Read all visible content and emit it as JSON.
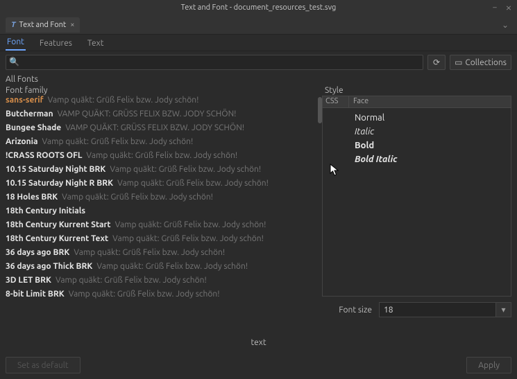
{
  "window": {
    "title": "Text and Font - document_resources_test.svg"
  },
  "doc_tab": {
    "label": "Text and Font",
    "icon": "T"
  },
  "subtabs": [
    {
      "label": "Font",
      "active": true
    },
    {
      "label": "Features",
      "active": false
    },
    {
      "label": "Text",
      "active": false
    }
  ],
  "toolbar": {
    "search_placeholder": "",
    "collections_label": "Collections"
  },
  "section_labels": {
    "all_fonts": "All Fonts",
    "font_family": "Font family",
    "style": "Style",
    "css": "CSS",
    "face": "Face",
    "font_size": "Font size",
    "text": "text"
  },
  "font_list": [
    {
      "name": "sans-serif",
      "selected": true,
      "preview": "Vamp quäkt: Grüß Felix bzw. Jody schön!"
    },
    {
      "name": "Butcherman",
      "preview": "VAMP QUÄKT: GRÜSS FELIX BZW. JODY SCHÖN!"
    },
    {
      "name": "Bungee Shade",
      "preview": "VAMP QUÄKT: GRÜSS FELIX BZW. JODY SCHÖN!"
    },
    {
      "name": "Arizonia",
      "preview": "Vamp quäkt: Grüß Felix bzw. Jody schön!"
    },
    {
      "name": "!CRASS ROOTS OFL",
      "preview": "Vamp quäkt: Grüß Felix bzw. Jody schön!"
    },
    {
      "name": "10.15 Saturday Night BRK",
      "preview": "Vamp quäkt: Grüß Felix bzw. Jody schön!"
    },
    {
      "name": "10.15 Saturday Night R BRK",
      "preview": "Vamp quäkt: Grüß Felix bzw. Jody schön!"
    },
    {
      "name": "18 Holes BRK",
      "preview": "Vamp quäkt: Grüß Felix bzw. Jody schön!"
    },
    {
      "name": "18th Century Initials",
      "preview": ""
    },
    {
      "name": "18th Century Kurrent Start",
      "preview": "Vamp quäkt: Grüß Felix bzw. Jody schön!"
    },
    {
      "name": "18th Century Kurrent Text",
      "preview": "Vamp quäkt: Grüß Felix bzw. Jody schön!"
    },
    {
      "name": "36 days ago BRK",
      "preview": "Vamp quäkt: Grüß Felix bzw. Jody schön!"
    },
    {
      "name": "36 days ago Thick BRK",
      "preview": "Vamp quäkt: Grüß Felix bzw. Jody schön!"
    },
    {
      "name": "3D LET BRK",
      "preview": "Vamp quäkt: Grüß Felix bzw. Jody schön!"
    },
    {
      "name": "8-bit Limit BRK",
      "preview": "Vamp quäkt: Grüß Felix bzw. Jody schön!"
    }
  ],
  "faces": [
    {
      "label": "Normal",
      "bold": false,
      "italic": false
    },
    {
      "label": "Italic",
      "bold": false,
      "italic": true
    },
    {
      "label": "Bold",
      "bold": true,
      "italic": false
    },
    {
      "label": "Bold Italic",
      "bold": true,
      "italic": true
    }
  ],
  "font_size_value": "18",
  "buttons": {
    "set_default": "Set as default",
    "apply": "Apply"
  }
}
